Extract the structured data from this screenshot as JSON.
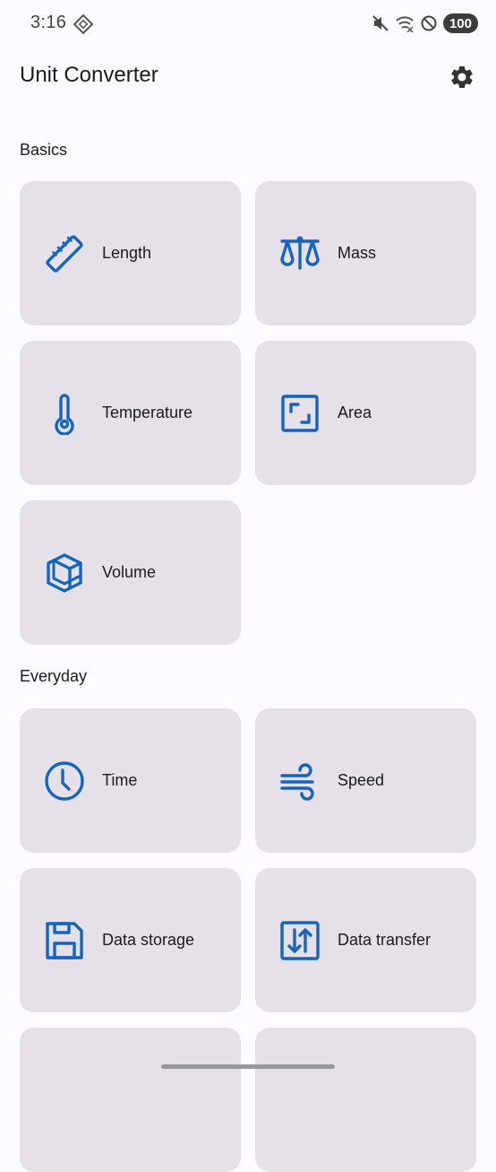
{
  "status_bar": {
    "time": "3:16",
    "battery": "100"
  },
  "app_bar": {
    "title": "Unit Converter",
    "settings_icon": "gear-icon"
  },
  "sections": [
    {
      "title": "Basics",
      "items": [
        {
          "label": "Length",
          "icon": "ruler-icon"
        },
        {
          "label": "Mass",
          "icon": "scale-icon"
        },
        {
          "label": "Temperature",
          "icon": "thermometer-icon"
        },
        {
          "label": "Area",
          "icon": "area-icon"
        },
        {
          "label": "Volume",
          "icon": "cube-icon"
        }
      ]
    },
    {
      "title": "Everyday",
      "items": [
        {
          "label": "Time",
          "icon": "clock-icon"
        },
        {
          "label": "Speed",
          "icon": "wind-icon"
        },
        {
          "label": "Data storage",
          "icon": "floppy-disk-icon"
        },
        {
          "label": "Data transfer",
          "icon": "transfer-arrows-icon"
        }
      ]
    }
  ],
  "colors": {
    "accent": "#1565c0",
    "card_background": "#e6e1e9",
    "page_background": "#fdfbff"
  }
}
